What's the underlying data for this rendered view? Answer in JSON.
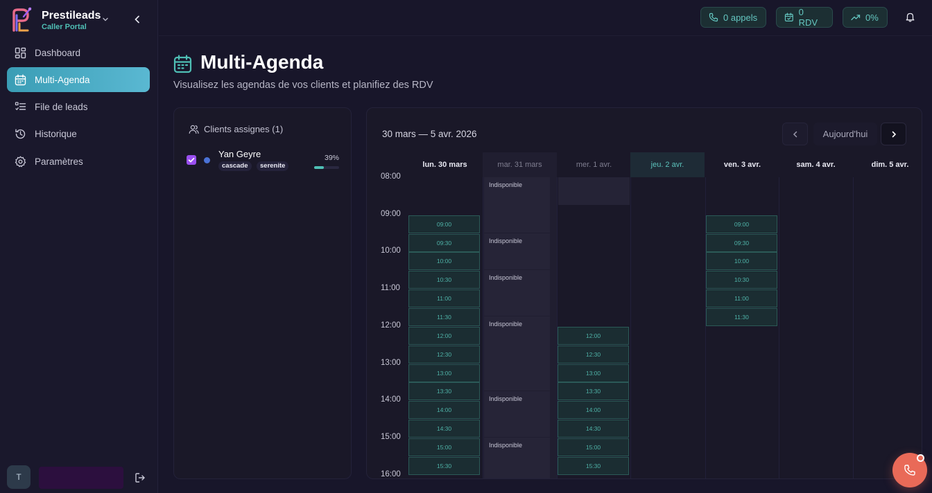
{
  "brand": {
    "name": "Prestileads",
    "subtitle": "Caller Portal"
  },
  "nav": {
    "items": [
      {
        "label": "Dashboard",
        "icon": "dashboard-icon",
        "active": false
      },
      {
        "label": "Multi-Agenda",
        "icon": "calendar-icon",
        "active": true
      },
      {
        "label": "File de leads",
        "icon": "list-icon",
        "active": false
      },
      {
        "label": "Historique",
        "icon": "history-icon",
        "active": false
      },
      {
        "label": "Paramètres",
        "icon": "gear-icon",
        "active": false
      }
    ]
  },
  "user": {
    "initial": "T"
  },
  "topbar": {
    "calls_label": "0 appels",
    "rdv_label": "0 RDV",
    "rate_label": "0%"
  },
  "page": {
    "title": "Multi-Agenda",
    "subtitle": "Visualisez les agendas de vos clients et planifiez des RDV"
  },
  "clients": {
    "header": "Clients assignes (1)",
    "list": [
      {
        "name": "Yan Geyre",
        "checked": true,
        "color": "#4a72d6",
        "tags": [
          "cascade",
          "serenite"
        ],
        "percent_label": "39%",
        "progress": 0.39
      }
    ]
  },
  "calendar": {
    "range": "30 mars — 5 avr. 2026",
    "today_button": "Aujourd'hui",
    "hours": [
      "08:00",
      "09:00",
      "10:00",
      "11:00",
      "12:00",
      "13:00",
      "14:00",
      "15:00",
      "16:00"
    ],
    "days": [
      {
        "label": "lun. 30 mars",
        "state": "normal"
      },
      {
        "label": "mar. 31 mars",
        "state": "muted"
      },
      {
        "label": "mer. 1 avr.",
        "state": "muted"
      },
      {
        "label": "jeu. 2 avr.",
        "state": "today"
      },
      {
        "label": "ven. 3 avr.",
        "state": "normal"
      },
      {
        "label": "sam. 4 avr.",
        "state": "normal"
      },
      {
        "label": "dim. 5 avr.",
        "state": "normal"
      }
    ],
    "monday_slots": [
      "09:00",
      "09:30",
      "10:00",
      "10:30",
      "11:00",
      "11:30",
      "12:00",
      "12:30",
      "13:00",
      "13:30",
      "14:00",
      "14:30",
      "15:00",
      "15:30"
    ],
    "wednesday_slots": [
      "12:00",
      "12:30",
      "13:00",
      "13:30",
      "14:00",
      "14:30",
      "15:00",
      "15:30"
    ],
    "friday_slots": [
      "09:00",
      "09:30",
      "10:00",
      "10:30",
      "11:00",
      "11:30"
    ],
    "unavailable_label": "Indisponible",
    "tuesday_unavailable_starts": [
      "08:00",
      "09:30",
      "10:30",
      "11:45",
      "13:45",
      "15:00"
    ]
  },
  "colors": {
    "accent": "#4fbfb5",
    "active_nav": "#3a9db5",
    "fab": "#e96a58",
    "slot_text": "#4fb3a8"
  }
}
